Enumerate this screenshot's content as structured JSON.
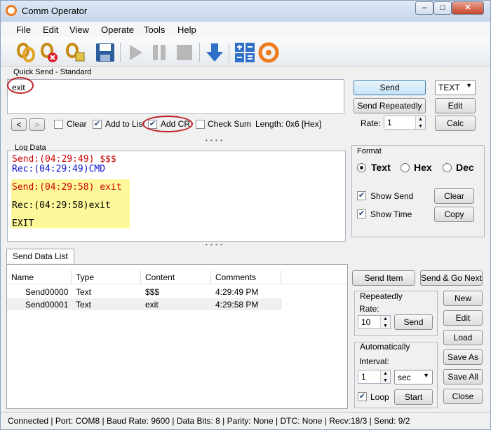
{
  "window": {
    "title": "Comm Operator",
    "min_btn": "–",
    "max_btn": "□",
    "close_btn": "✕"
  },
  "menu": {
    "items": [
      "File",
      "Edit",
      "View",
      "Operate",
      "Tools",
      "Help"
    ]
  },
  "quick_send": {
    "label": "Quick Send - Standard",
    "text_value": "exit",
    "send": "Send",
    "send_repeatedly": "Send Repeatedly",
    "format_value": "TEXT",
    "edit": "Edit",
    "calc": "Calc",
    "rate_label": "Rate:",
    "rate_value": "1",
    "prev": "<",
    "next": ">",
    "clear_label": "Clear",
    "add_to_list_label": "Add to List",
    "add_cr_label": "Add CR",
    "check_sum_label": "Check Sum",
    "length": "Length: 0x6 [Hex]",
    "check_mark": "✔"
  },
  "log": {
    "label": "Log Data",
    "lines": [
      {
        "text": "Send:(04:29:49) $$$",
        "color": "#cc0000"
      },
      {
        "text": "Rec:(04:29:49)CMD",
        "color": "#1010cc"
      },
      {
        "text": "Send:(04:29:58) exit",
        "color": "#cc0000"
      },
      {
        "text": "Rec:(04:29:58)exit",
        "color": "#000000"
      },
      {
        "text": "EXIT",
        "color": "#000000"
      }
    ],
    "highlight_color": "#fdf99b"
  },
  "format": {
    "label": "Format",
    "text": "Text",
    "hex": "Hex",
    "dec": "Dec",
    "show_send": "Show Send",
    "show_time": "Show Time",
    "clear": "Clear",
    "copy": "Copy"
  },
  "send_list": {
    "tab": "Send Data List",
    "columns": [
      "Name",
      "Type",
      "Content",
      "Comments"
    ],
    "rows": [
      {
        "name": "Send00000",
        "type": "Text",
        "content": "$$$",
        "comments": "4:29:49 PM"
      },
      {
        "name": "Send00001",
        "type": "Text",
        "content": "exit",
        "comments": "4:29:58 PM"
      }
    ]
  },
  "list_controls": {
    "send_item": "Send Item",
    "send_go_next": "Send & Go Next",
    "repeatedly": "Repeatedly",
    "rate_label": "Rate:",
    "rate_value": "10",
    "send": "Send",
    "automatically": "Automatically",
    "interval_label": "Interval:",
    "interval_value": "1",
    "unit_value": "sec",
    "loop": "Loop",
    "start": "Start",
    "new": "New",
    "edit": "Edit",
    "load": "Load",
    "save_as": "Save As",
    "save_all": "Save All",
    "close": "Close"
  },
  "status": "Connected | Port: COM8 | Baud Rate: 9600 | Data Bits: 8 | Parity: None | DTC: None | Recv:18/3 | Send: 9/2",
  "colors": {
    "accent": "#f07a1a",
    "annotation": "#c0212a"
  }
}
